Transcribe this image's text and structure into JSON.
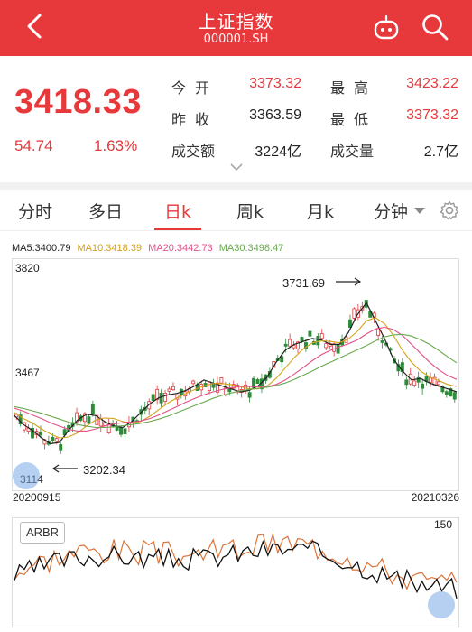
{
  "header": {
    "title": "上证指数",
    "code": "000001.SH"
  },
  "quote": {
    "price": "3418.33",
    "change": "54.74",
    "change_pct": "1.63%",
    "stats": [
      {
        "label": "今开",
        "value": "3373.32"
      },
      {
        "label": "最高",
        "value": "3423.22"
      },
      {
        "label": "昨收",
        "value": "3363.59"
      },
      {
        "label": "最低",
        "value": "3373.32"
      },
      {
        "label": "成交额",
        "value": "3224亿"
      },
      {
        "label": "成交量",
        "value": "2.7亿"
      }
    ]
  },
  "tabs": [
    "分时",
    "多日",
    "日k",
    "周k",
    "月k",
    "分钟"
  ],
  "active_tab": "日k",
  "ma": {
    "ma5": "MA5:3400.79",
    "ma10": "MA10:3418.39",
    "ma20": "MA20:3442.73",
    "ma30": "MA30:3498.47"
  },
  "colors": {
    "brand_red": "#e7393b",
    "up_red": "#e0393b",
    "down_green": "#2e8b3a",
    "ma5": "#222222",
    "ma10": "#d4a21a",
    "ma20": "#e0508a",
    "ma30": "#6aa84f",
    "arbr_ar": "#111111",
    "arbr_br": "#d9743a"
  },
  "chart": {
    "y_top": "3820",
    "y_mid": "3467",
    "y_bottom": "3114",
    "start_date": "20200915",
    "end_date": "20210326",
    "high_annotation": "3731.69",
    "low_annotation": "3202.34"
  },
  "indicator": {
    "name": "ARBR",
    "max": "150"
  },
  "chart_data": {
    "type": "line",
    "title": "",
    "x_range": [
      "20200915",
      "20210326"
    ],
    "ylim": [
      3114,
      3820
    ],
    "series": [
      {
        "name": "MA5",
        "values": [
          3320,
          3290,
          3270,
          3245,
          3225,
          3230,
          3270,
          3305,
          3325,
          3320,
          3300,
          3285,
          3280,
          3300,
          3330,
          3360,
          3380,
          3390,
          3395,
          3405,
          3420,
          3440,
          3430,
          3420,
          3410,
          3400,
          3405,
          3420,
          3450,
          3500,
          3540,
          3560,
          3570,
          3580,
          3575,
          3560,
          3560,
          3600,
          3660,
          3700,
          3640,
          3580,
          3510,
          3470,
          3440,
          3445,
          3430,
          3420,
          3410,
          3400
        ]
      },
      {
        "name": "MA10",
        "values": [
          3330,
          3310,
          3295,
          3275,
          3258,
          3245,
          3248,
          3262,
          3285,
          3305,
          3312,
          3310,
          3300,
          3295,
          3300,
          3318,
          3340,
          3362,
          3380,
          3395,
          3408,
          3420,
          3428,
          3428,
          3424,
          3418,
          3410,
          3410,
          3420,
          3445,
          3480,
          3515,
          3545,
          3565,
          3572,
          3570,
          3566,
          3578,
          3604,
          3640,
          3650,
          3630,
          3590,
          3540,
          3500,
          3470,
          3450,
          3438,
          3425,
          3418
        ]
      },
      {
        "name": "MA20",
        "values": [
          3345,
          3335,
          3322,
          3310,
          3296,
          3284,
          3274,
          3268,
          3268,
          3275,
          3285,
          3292,
          3296,
          3298,
          3302,
          3310,
          3322,
          3336,
          3350,
          3365,
          3378,
          3390,
          3400,
          3408,
          3414,
          3418,
          3418,
          3417,
          3418,
          3425,
          3440,
          3460,
          3482,
          3505,
          3525,
          3540,
          3552,
          3562,
          3575,
          3595,
          3612,
          3618,
          3610,
          3590,
          3560,
          3530,
          3500,
          3475,
          3455,
          3442
        ]
      },
      {
        "name": "MA30",
        "values": [
          3350,
          3344,
          3336,
          3328,
          3318,
          3308,
          3298,
          3290,
          3284,
          3280,
          3280,
          3282,
          3286,
          3290,
          3294,
          3300,
          3308,
          3318,
          3330,
          3342,
          3354,
          3366,
          3378,
          3388,
          3396,
          3403,
          3408,
          3412,
          3416,
          3421,
          3430,
          3442,
          3456,
          3470,
          3486,
          3500,
          3514,
          3528,
          3542,
          3556,
          3572,
          3585,
          3592,
          3594,
          3588,
          3576,
          3560,
          3540,
          3518,
          3498
        ]
      }
    ]
  }
}
